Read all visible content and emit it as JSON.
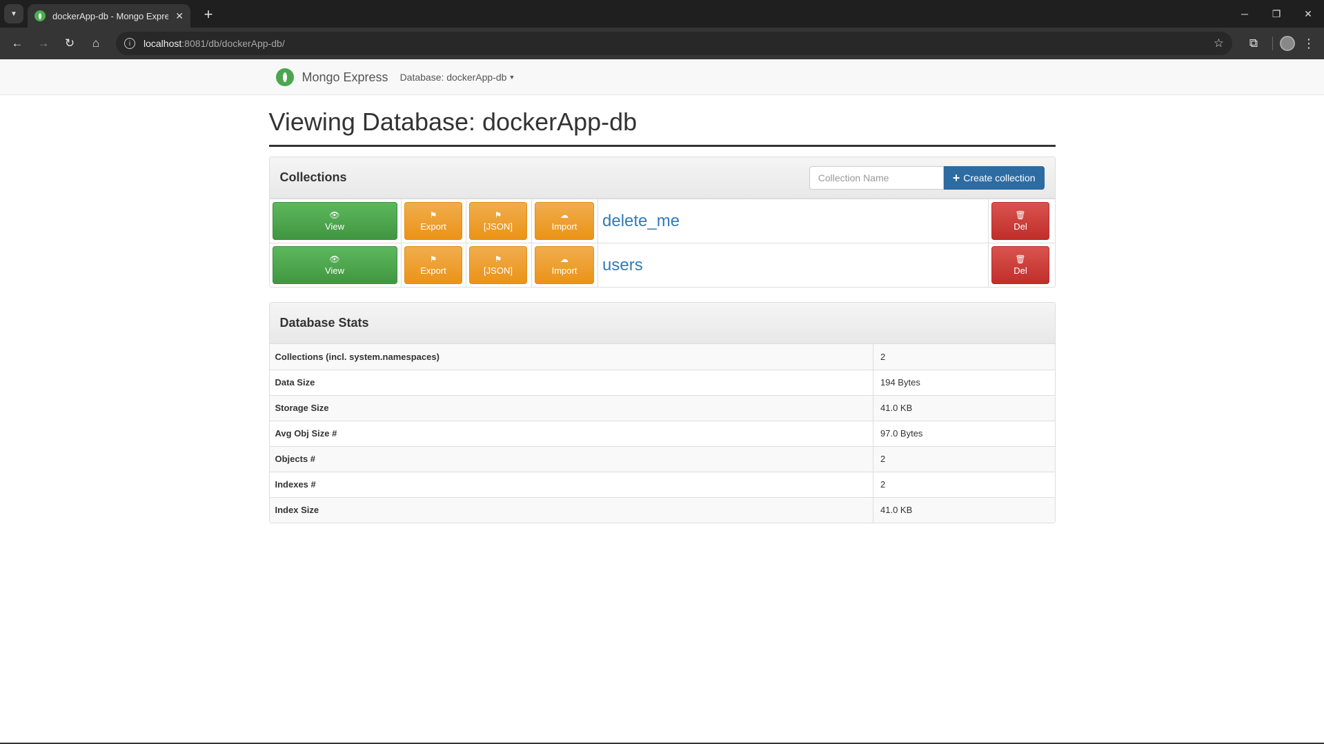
{
  "browser": {
    "tab_title": "dockerApp-db - Mongo Express",
    "url_host": "localhost",
    "url_path": ":8081/db/dockerApp-db/"
  },
  "navbar": {
    "brand": "Mongo Express",
    "db_label": "Database: dockerApp-db"
  },
  "page": {
    "title": "Viewing Database: dockerApp-db"
  },
  "collections_panel": {
    "title": "Collections",
    "input_placeholder": "Collection Name",
    "create_label": "Create collection",
    "buttons": {
      "view": "View",
      "export": "Export",
      "json": "[JSON]",
      "import": "Import",
      "del": "Del"
    },
    "collections": [
      "delete_me",
      "users"
    ]
  },
  "stats_panel": {
    "title": "Database Stats",
    "rows": [
      {
        "label": "Collections (incl. system.namespaces)",
        "value": "2"
      },
      {
        "label": "Data Size",
        "value": "194 Bytes"
      },
      {
        "label": "Storage Size",
        "value": "41.0 KB"
      },
      {
        "label": "Avg Obj Size #",
        "value": "97.0 Bytes"
      },
      {
        "label": "Objects #",
        "value": "2"
      },
      {
        "label": "Indexes #",
        "value": "2"
      },
      {
        "label": "Index Size",
        "value": "41.0 KB"
      }
    ]
  },
  "colors": {
    "success": "#5cb85c",
    "warning": "#f0ad4e",
    "danger": "#d9534f",
    "primary": "#2d6ca2",
    "link": "#337ab7"
  }
}
